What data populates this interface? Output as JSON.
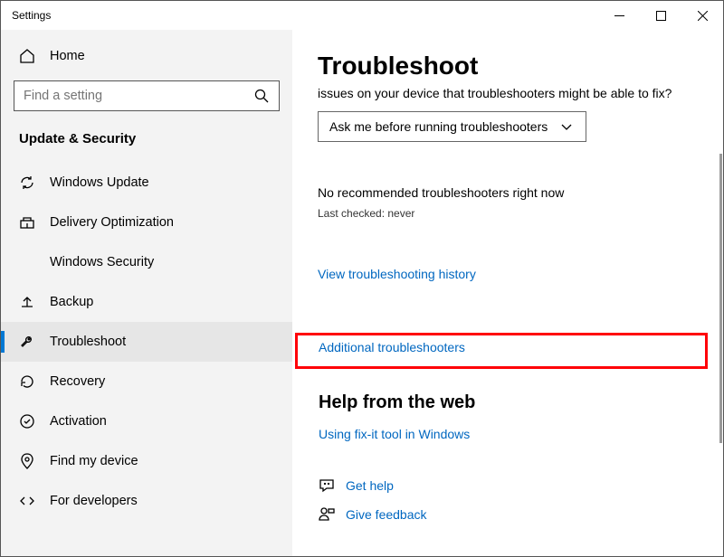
{
  "window": {
    "title": "Settings"
  },
  "sidebar": {
    "home": "Home",
    "searchPlaceholder": "Find a setting",
    "section": "Update & Security",
    "items": [
      {
        "label": "Windows Update"
      },
      {
        "label": "Delivery Optimization"
      },
      {
        "label": "Windows Security"
      },
      {
        "label": "Backup"
      },
      {
        "label": "Troubleshoot"
      },
      {
        "label": "Recovery"
      },
      {
        "label": "Activation"
      },
      {
        "label": "Find my device"
      },
      {
        "label": "For developers"
      }
    ]
  },
  "content": {
    "title": "Troubleshoot",
    "subtitle": "issues on your device that troubleshooters might be able to fix?",
    "dropdownValue": "Ask me before running troubleshooters",
    "statusMain": "No recommended troubleshooters right now",
    "statusSub": "Last checked: never",
    "historyLink": "View troubleshooting history",
    "additionalLink": "Additional troubleshooters",
    "helpSection": "Help from the web",
    "fixLink": "Using fix-it tool in Windows",
    "getHelp": "Get help",
    "feedback": "Give feedback"
  }
}
